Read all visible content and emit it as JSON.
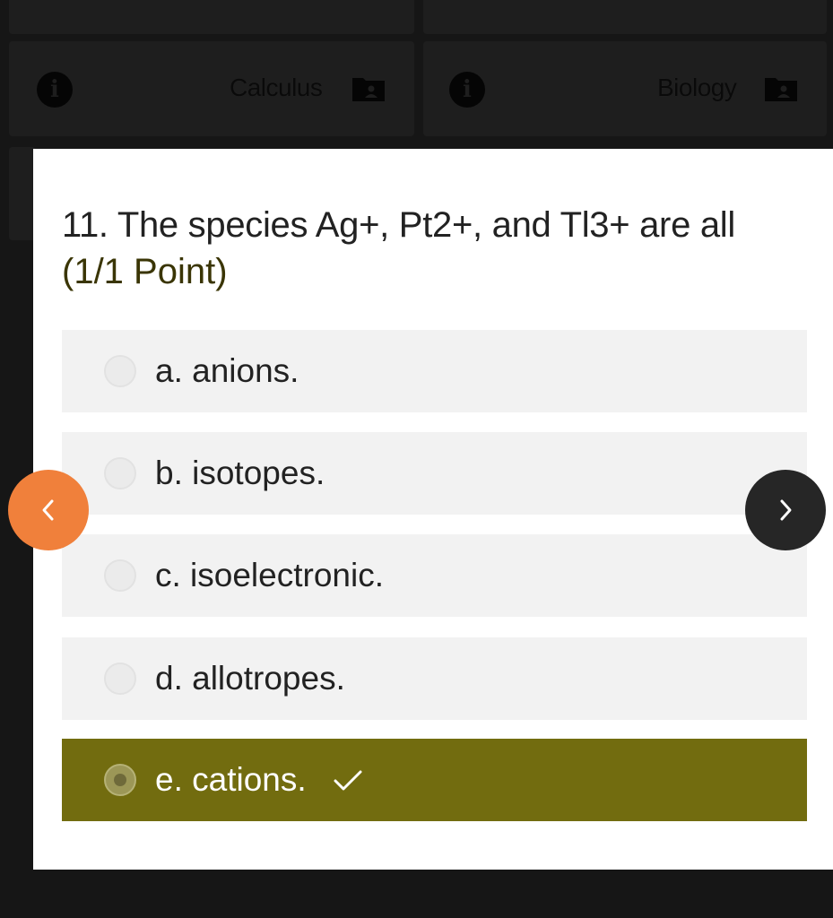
{
  "background": {
    "tiles": [
      {
        "subject": "Calculus",
        "icons": [
          "info-icon",
          "folder-icon"
        ]
      },
      {
        "subject": "Biology",
        "icons": [
          "info-icon",
          "folder-icon"
        ]
      }
    ]
  },
  "question": {
    "text": "11. The species Ag+, Pt2+, and Tl3+ are all",
    "points": "(1/1 Point)"
  },
  "options": [
    {
      "label": "a. anions.",
      "selected": false
    },
    {
      "label": "b. isotopes.",
      "selected": false
    },
    {
      "label": "c. isoelectronic.",
      "selected": false
    },
    {
      "label": "d. allotropes.",
      "selected": false
    },
    {
      "label": "e. cations.",
      "selected": true,
      "correct": true
    }
  ],
  "navigation": {
    "prev_icon": "chevron-left-icon",
    "next_icon": "chevron-right-icon"
  },
  "colors": {
    "correct_answer_bg": "#726c0f",
    "prev_button": "#f0803b",
    "next_button": "#262626",
    "page_bg": "#161616"
  }
}
